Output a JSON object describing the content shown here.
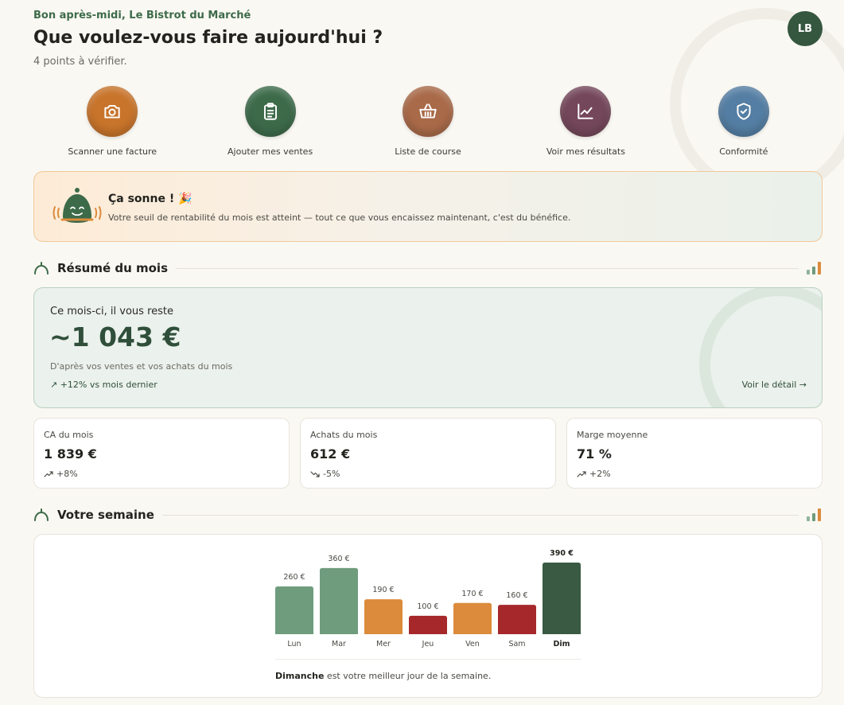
{
  "header": {
    "greeting": "Bon après-midi, Le Bistrot du Marché",
    "headline": "Que voulez-vous faire aujourd'hui ?",
    "subtitle": "4 points à vérifier.",
    "avatar_initials": "LB"
  },
  "actions": [
    {
      "label": "Scanner une facture",
      "icon": "camera-icon",
      "color": "#c8742b"
    },
    {
      "label": "Ajouter mes ventes",
      "icon": "clipboard-icon",
      "color": "#3d6b4a"
    },
    {
      "label": "Liste de course",
      "icon": "basket-icon",
      "color": "#a96a49"
    },
    {
      "label": "Voir mes résultats",
      "icon": "chart-line-icon",
      "color": "#74475a"
    },
    {
      "label": "Conformité",
      "icon": "shield-check-icon",
      "color": "#547ea3"
    }
  ],
  "alarm": {
    "title": "Ça sonne !",
    "emoji": "🎉",
    "text": "Votre seuil de rentabilité du mois est atteint — tout ce que vous encaissez maintenant, c'est du bénéfice."
  },
  "month_summary": {
    "section_title": "Résumé du mois",
    "label": "Ce mois-ci, il vous reste",
    "amount": "~1 043 €",
    "note": "D'après vos ventes et vos achats du mois",
    "trend": "↗ +12% vs mois dernier",
    "detail_link": "Voir le détail →"
  },
  "stats": [
    {
      "label": "CA du mois",
      "value": "1 839 €",
      "trend": "+8%",
      "direction": "up"
    },
    {
      "label": "Achats du mois",
      "value": "612 €",
      "trend": "-5%",
      "direction": "down"
    },
    {
      "label": "Marge moyenne",
      "value": "71 %",
      "trend": "+2%",
      "direction": "up"
    }
  ],
  "week": {
    "section_title": "Votre semaine",
    "caption_bold": "Dimanche",
    "caption_rest": " est votre meilleur jour de la semaine."
  },
  "colors": {
    "green_dark": "#3a5a43",
    "green_light": "#6e9c7d",
    "orange": "#db8b3b",
    "red": "#a6282a"
  },
  "chart_data": {
    "type": "bar",
    "categories": [
      "Lun",
      "Mar",
      "Mer",
      "Jeu",
      "Ven",
      "Sam",
      "Dim"
    ],
    "values": [
      260,
      360,
      190,
      100,
      170,
      160,
      390
    ],
    "data_labels": [
      "260 €",
      "360 €",
      "190 €",
      "100 €",
      "170 €",
      "160 €",
      "390 €"
    ],
    "bar_colors": [
      "#6e9c7d",
      "#6e9c7d",
      "#db8b3b",
      "#a6282a",
      "#db8b3b",
      "#a6282a",
      "#3a5a43"
    ],
    "highlight": "Dim",
    "ylim": [
      0,
      390
    ],
    "grid": false,
    "title": "",
    "xlabel": "",
    "ylabel": ""
  }
}
